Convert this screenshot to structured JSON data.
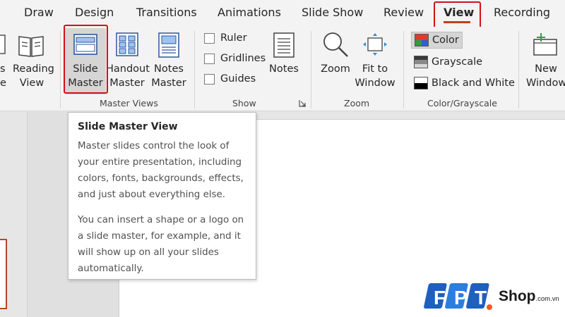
{
  "tabs": [
    {
      "label": "Draw"
    },
    {
      "label": "Design"
    },
    {
      "label": "Transitions"
    },
    {
      "label": "Animations"
    },
    {
      "label": "Slide Show"
    },
    {
      "label": "Review"
    },
    {
      "label": "View",
      "active": true
    },
    {
      "label": "Recording"
    }
  ],
  "ribbon": {
    "views": {
      "partial_label_1": "s",
      "partial_label_2": "e",
      "reading_view": [
        "Reading",
        "View"
      ]
    },
    "master_views": {
      "group_label": "Master Views",
      "slide_master": [
        "Slide",
        "Master"
      ],
      "handout_master": [
        "Handout",
        "Master"
      ],
      "notes_master": [
        "Notes",
        "Master"
      ]
    },
    "show": {
      "group_label": "Show",
      "ruler": "Ruler",
      "gridlines": "Gridlines",
      "guides": "Guides",
      "notes": "Notes"
    },
    "zoom": {
      "group_label": "Zoom",
      "zoom": "Zoom",
      "fit_to_window": [
        "Fit to",
        "Window"
      ]
    },
    "color_grayscale": {
      "group_label": "Color/Grayscale",
      "color": "Color",
      "grayscale": "Grayscale",
      "black_and_white": "Black and White",
      "colors": {
        "red": "#e03a2f",
        "green": "#2e9b48",
        "blue": "#2f5fd0"
      }
    },
    "window": {
      "new_window": [
        "New",
        "Window"
      ]
    }
  },
  "tooltip": {
    "title": "Slide Master View",
    "para1": [
      "Master slides control the look of",
      "your entire presentation, including",
      "colors, fonts, backgrounds, effects,",
      "and just about everything else."
    ],
    "para2": [
      "You can insert a shape or a logo on",
      "a slide master, for example, and it",
      "will show up on all your slides",
      "automatically."
    ]
  },
  "watermark": {
    "logo_letters": [
      "F",
      "P",
      "T"
    ],
    "brand": "Shop",
    "domain": ".com.vn",
    "colors": {
      "f": "#1f5fbf",
      "p": "#1f5fbf",
      "t": "#1f5fbf",
      "accent": "#f15a22"
    }
  },
  "colors": {
    "highlight": "#d0121a",
    "accent_underline": "#c43e1c",
    "ribbon_bg": "#f3f3f3"
  }
}
